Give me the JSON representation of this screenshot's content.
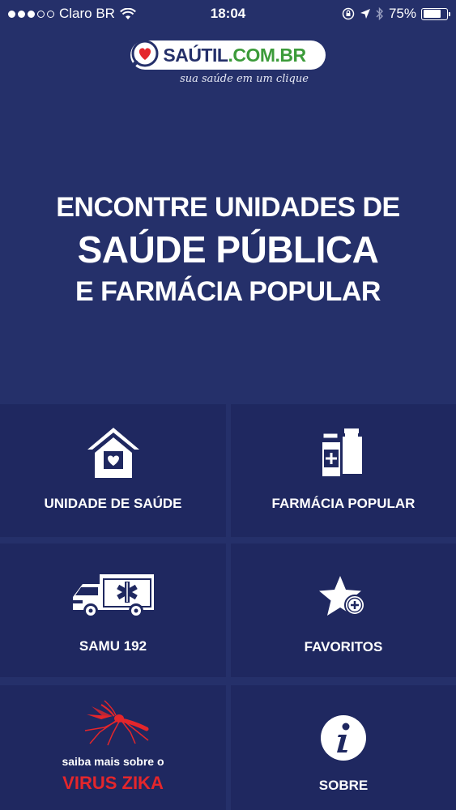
{
  "status_bar": {
    "carrier": "Claro BR",
    "time": "18:04",
    "battery": "75%",
    "battery_level": 0.75
  },
  "logo": {
    "name": "SAÚTIL",
    "domain": ".COM.BR",
    "tagline": "sua saúde em um clique"
  },
  "headline": {
    "line1": "ENCONTRE UNIDADES DE",
    "line2": "SAÚDE PÚBLICA",
    "line3": "E FARMÁCIA POPULAR"
  },
  "tiles": {
    "unidade": {
      "label": "UNIDADE DE SAÚDE",
      "icon": "health-house-icon"
    },
    "farmacia": {
      "label": "FARMÁCIA POPULAR",
      "icon": "medicine-bottles-icon"
    },
    "samu": {
      "label": "SAMU 192",
      "icon": "ambulance-icon"
    },
    "favoritos": {
      "label": "FAVORITOS",
      "icon": "star-plus-icon"
    },
    "zika": {
      "pre": "saiba mais sobre o",
      "label": "VIRUS ZIKA",
      "icon": "mosquito-icon"
    },
    "sobre": {
      "label": "SOBRE",
      "icon": "info-icon"
    }
  },
  "colors": {
    "background": "#25306a",
    "tile": "#1f2860",
    "zika_red": "#e4262b",
    "logo_green": "#3c9b3a"
  }
}
